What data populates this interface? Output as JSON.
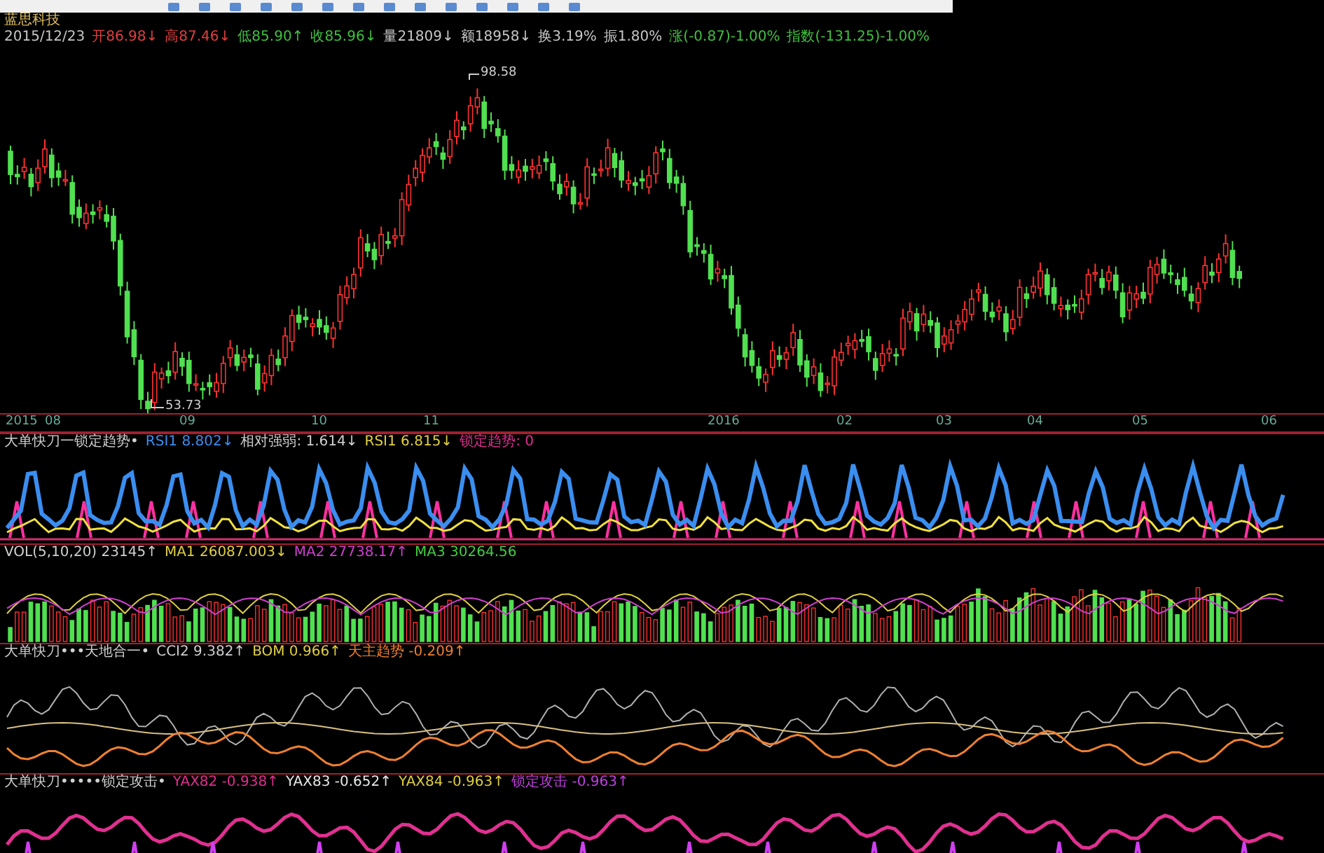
{
  "stock": {
    "name": "蓝思科技"
  },
  "quote": [
    {
      "text": "2015/12/23",
      "color": "#c8c8c8"
    },
    {
      "text": "开86.98↓",
      "color": "#e04040"
    },
    {
      "text": "高87.46↓",
      "color": "#e04040"
    },
    {
      "text": "低85.90↑",
      "color": "#40c040"
    },
    {
      "text": "收85.96↓",
      "color": "#40c040"
    },
    {
      "text": "量21809↓",
      "color": "#c8c8c8"
    },
    {
      "text": "额18958↓",
      "color": "#c8c8c8"
    },
    {
      "text": "换3.19%",
      "color": "#c8c8c8"
    },
    {
      "text": "振1.80%",
      "color": "#c8c8c8"
    },
    {
      "text": "涨(-0.87)-1.00%",
      "color": "#40c040"
    },
    {
      "text": "指数(-131.25)-1.00%",
      "color": "#40c040"
    }
  ],
  "price_labels": {
    "high": "98.58",
    "low": "53.73"
  },
  "date_axis": [
    "2015",
    "08",
    "09",
    "10",
    "11",
    "2016",
    "02",
    "03",
    "04",
    "05",
    "06"
  ],
  "panels": [
    {
      "kind": "trend",
      "items": [
        {
          "text": "大单快刀一锁定趋势•",
          "color": "#d0d0d0"
        },
        {
          "text": "RSI1 8.802↓",
          "color": "#3a8ef0"
        },
        {
          "text": "相对强弱: 1.614↓",
          "color": "#d0d0d0"
        },
        {
          "text": "RSI1 6.815↓",
          "color": "#e0d040"
        },
        {
          "text": "锁定趋势: 0",
          "color": "#e03090"
        }
      ]
    },
    {
      "kind": "volume",
      "items": [
        {
          "text": "VOL(5,10,20) 23145↑",
          "color": "#d0d0d0"
        },
        {
          "text": "MA1 26087.003↓",
          "color": "#e0d040"
        },
        {
          "text": "MA2 27738.17↑",
          "color": "#d040d0"
        },
        {
          "text": "MA3 30264.56",
          "color": "#40d040"
        }
      ]
    },
    {
      "kind": "cci",
      "items": [
        {
          "text": "大单快刀•••天地合一•",
          "color": "#d0d0d0"
        },
        {
          "text": "CCI2 9.382↑",
          "color": "#d0d0d0"
        },
        {
          "text": "BOM 0.966↑",
          "color": "#e0d040"
        },
        {
          "text": "天主趋势 -0.209↑",
          "color": "#f08030"
        }
      ]
    },
    {
      "kind": "attack",
      "items": [
        {
          "text": "大单快刀•••••锁定攻击•",
          "color": "#d0d0d0"
        },
        {
          "text": "YAX82 -0.938↑",
          "color": "#e03090"
        },
        {
          "text": "YAX83 -0.652↑",
          "color": "#e8e8e8"
        },
        {
          "text": "YAX84 -0.963↑",
          "color": "#e0d040"
        },
        {
          "text": "锁定攻击 -0.963↑",
          "color": "#c040e0"
        }
      ]
    }
  ]
}
